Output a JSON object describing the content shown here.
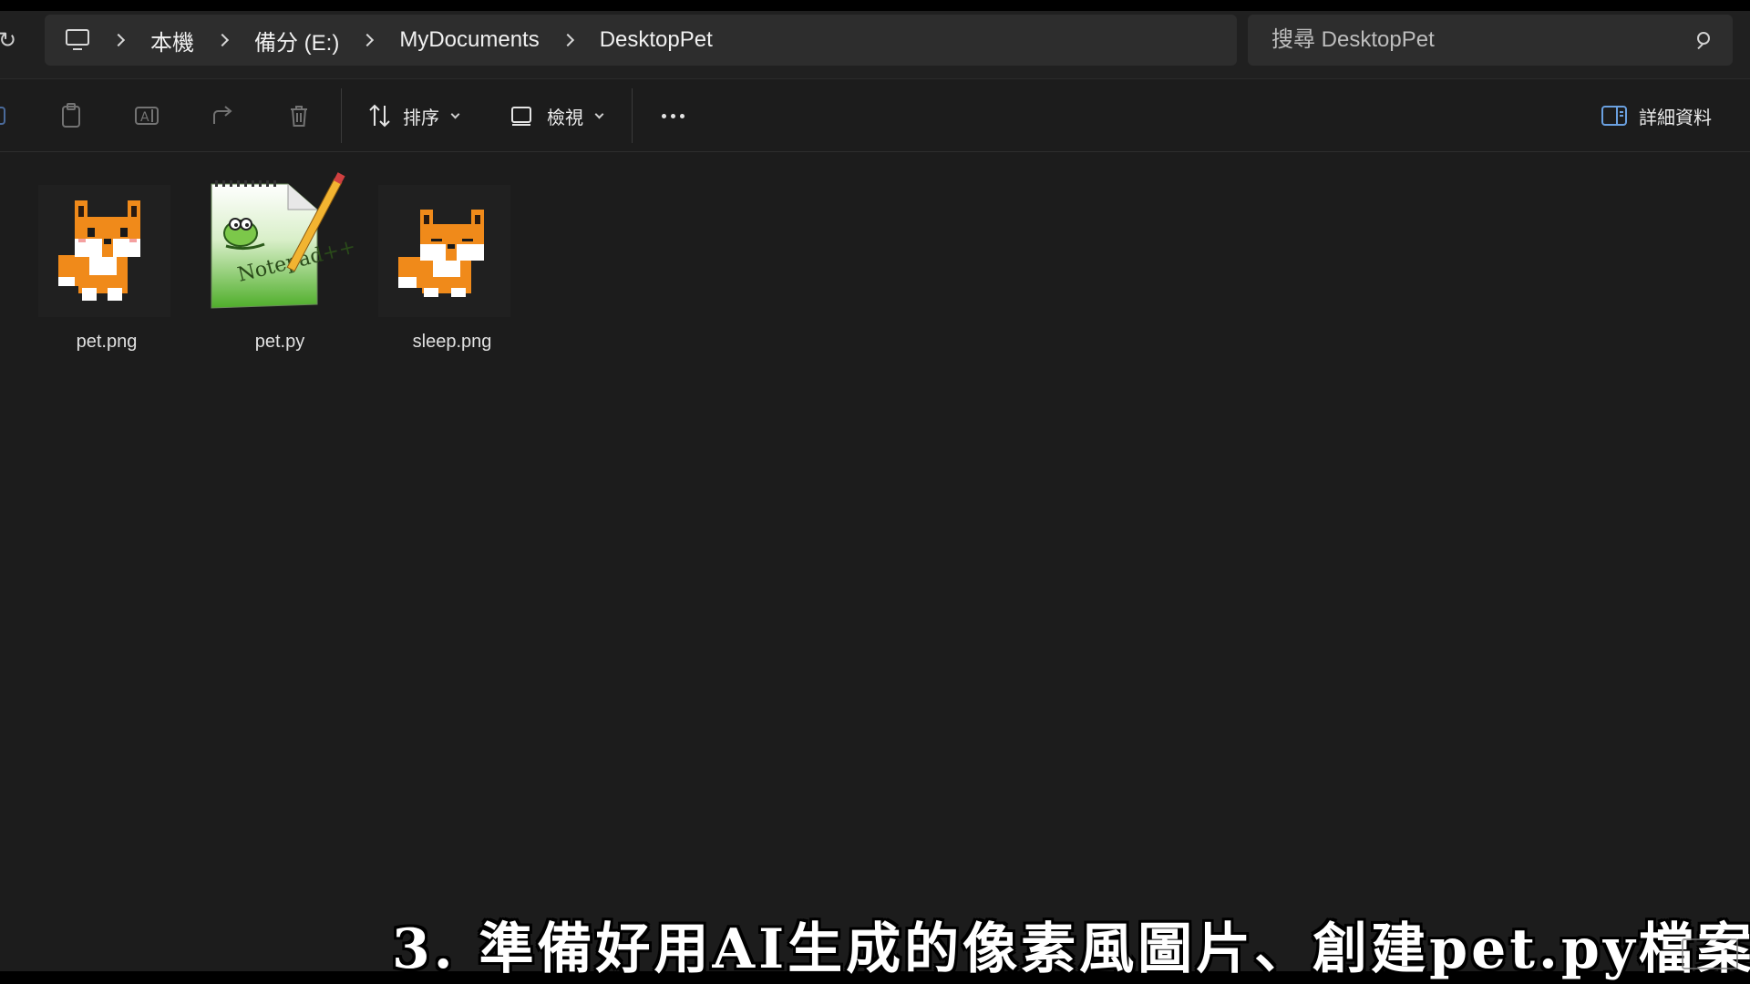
{
  "address_bar": {
    "breadcrumbs": [
      "本機",
      "備分 (E:)",
      "MyDocuments",
      "DesktopPet"
    ],
    "search_placeholder": "搜尋 DesktopPet"
  },
  "toolbar": {
    "sort_label": "排序",
    "view_label": "檢視",
    "details_label": "詳細資料"
  },
  "files": [
    {
      "name": "pet.png",
      "icon": "fox-sitting-pixel-icon"
    },
    {
      "name": "pet.py",
      "icon": "notepad-plus-plus-icon"
    },
    {
      "name": "sleep.png",
      "icon": "fox-sleeping-pixel-icon"
    }
  ],
  "subtitle": "3. 準備好用AI生成的像素風圖片、創建pet.py檔案",
  "colors": {
    "background": "#1c1c1c",
    "bar": "#2d2d2d",
    "fox_orange": "#f08a1a",
    "notepad_green": "#6cc33a"
  }
}
